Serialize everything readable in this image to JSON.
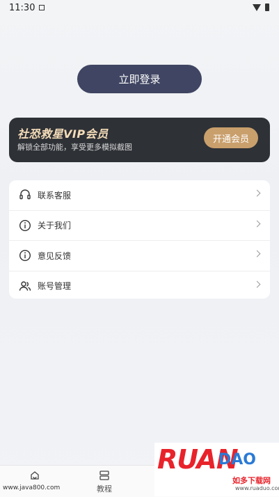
{
  "status_bar": {
    "time": "11:30"
  },
  "login": {
    "label": "立即登录"
  },
  "vip": {
    "title": "社恐救星VIP会员",
    "subtitle": "解锁全部功能，享受更多模拟截图",
    "button": "开通会员"
  },
  "menu": {
    "items": [
      {
        "label": "联系客服",
        "icon": "headset-icon"
      },
      {
        "label": "关于我们",
        "icon": "info-icon"
      },
      {
        "label": "意见反馈",
        "icon": "info-icon"
      },
      {
        "label": "账号管理",
        "icon": "users-icon"
      }
    ]
  },
  "tabbar": {
    "tabs": [
      {
        "label": "教程",
        "icon": "tutorial-icon"
      }
    ]
  },
  "watermark": {
    "left": "www.java800.com",
    "logo_big": "RUAN",
    "logo_big2": "DAO",
    "logo_small": "如多下载网",
    "logo_url": "www.ruaduo.com"
  },
  "colors": {
    "login_bg": "#3f4562",
    "vip_bg": "#2e3136",
    "vip_title": "#f4dcb8",
    "vip_button": "#c99f6c"
  }
}
